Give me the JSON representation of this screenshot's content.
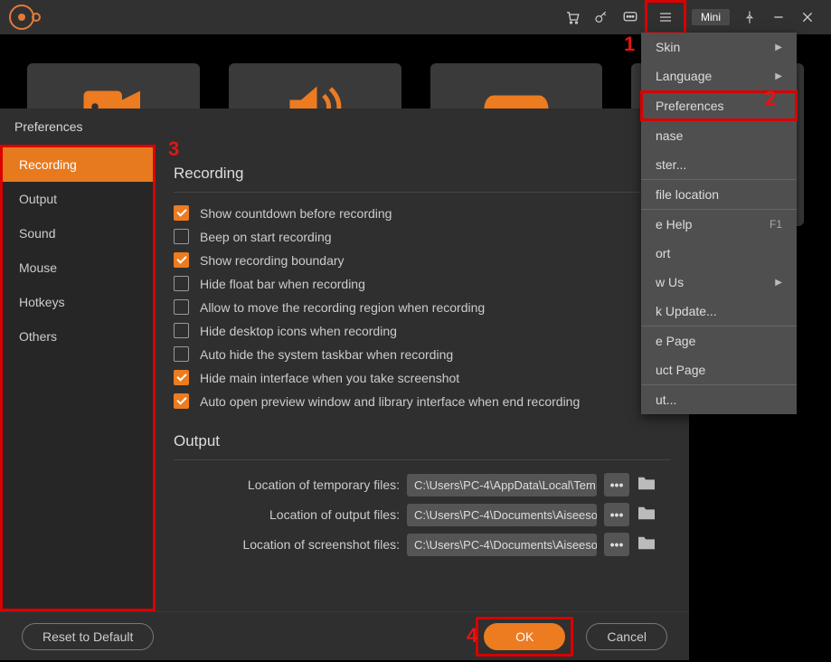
{
  "titlebar": {
    "mini": "Mini"
  },
  "dropdown": {
    "skin": "Skin",
    "language": "Language",
    "preferences": "Preferences",
    "purchase": "nase",
    "register": "ster...",
    "open_file_location": "file location",
    "online_help": "e Help",
    "help_key": "F1",
    "support": "ort",
    "follow_us": "w Us",
    "check_update": "k Update...",
    "home_page": "e Page",
    "product_page": "uct Page",
    "about": "ut..."
  },
  "prefs": {
    "title": "Preferences",
    "sidebar": {
      "recording": "Recording",
      "output": "Output",
      "sound": "Sound",
      "mouse": "Mouse",
      "hotkeys": "Hotkeys",
      "others": "Others"
    },
    "recording": {
      "heading": "Recording",
      "c1": "Show countdown before recording",
      "c2": "Beep on start recording",
      "c3": "Show recording boundary",
      "c4": "Hide float bar when recording",
      "c5": "Allow to move the recording region when recording",
      "c6": "Hide desktop icons when recording",
      "c7": "Auto hide the system taskbar when recording",
      "c8": "Hide main interface when you take screenshot",
      "c9": "Auto open preview window and library interface when end recording"
    },
    "output": {
      "heading": "Output",
      "l1": "Location of temporary files:",
      "l2": "Location of output files:",
      "l3": "Location of screenshot files:",
      "v1": "C:\\Users\\PC-4\\AppData\\Local\\Tem",
      "v2": "C:\\Users\\PC-4\\Documents\\Aiseeso",
      "v3": "C:\\Users\\PC-4\\Documents\\Aiseeso"
    },
    "footer": {
      "reset": "Reset to Default",
      "ok": "OK",
      "cancel": "Cancel"
    }
  },
  "steps": {
    "s1": "1",
    "s2": "2",
    "s3": "3",
    "s4": "4"
  }
}
